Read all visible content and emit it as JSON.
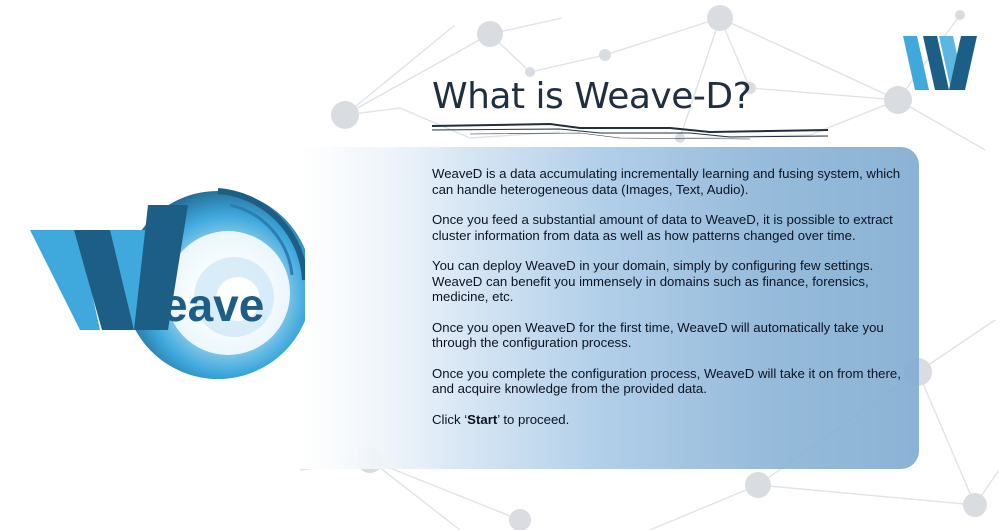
{
  "page": {
    "title": "What is Weave-D?"
  },
  "intro": {
    "p1": "WeaveD is a data accumulating incrementally learning and fusing system, which can handle heterogeneous data (Images, Text, Audio).",
    "p2": "Once you feed a substantial amount of data to WeaveD, it is possible to extract cluster information from data as well as how patterns changed over time.",
    "p3": "You can deploy WeaveD in your domain, simply by configuring few settings. WeaveD can benefit you immensely in domains such as finance, forensics, medicine, etc.",
    "p4": "Once you open WeaveD for the first time, WeaveD will automatically take you through the configuration process.",
    "p5": "Once you complete the configuration process, WeaveD will take it on from there, and acquire knowledge from the provided data.",
    "start_prefix": "Click ‘",
    "start_word": "Start",
    "start_suffix": "’ to proceed."
  },
  "logo": {
    "wordmark": "eave",
    "corner_letter": "W",
    "big_letter": "W"
  },
  "colors": {
    "accent_dark": "#1d5e86",
    "accent_light": "#3fa9dd",
    "text": "#0c1320",
    "title": "#1f2f40"
  },
  "icons": {
    "corner": "weave-w-logo-icon",
    "main": "weave-swirl-logo-icon"
  }
}
